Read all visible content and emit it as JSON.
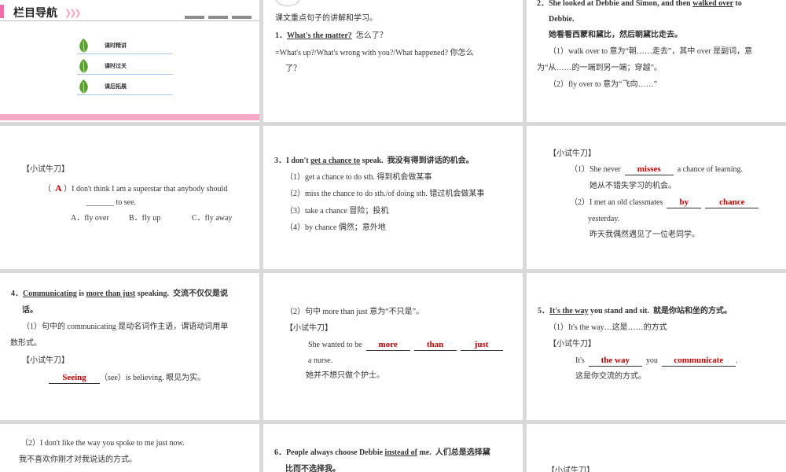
{
  "nav": {
    "title": "栏目导航",
    "arrows": "❯❯❯",
    "items": [
      {
        "label": "课时精讲"
      },
      {
        "label": "课时过关"
      },
      {
        "label": "课后拓展"
      }
    ],
    "colors": {
      "accent": "#f26ca7",
      "bar": "#f7a8c8",
      "leaf": "#5aa02c"
    }
  },
  "s2": {
    "intro": "课文重点句子的讲解和学习。",
    "heading_num": "1．",
    "heading_en": "What's the matter?",
    "heading_cn": "怎么了？",
    "line1": "=What's up?/What's wrong with you?/What happened? 你怎么",
    "line2": "了？"
  },
  "s3": {
    "h_num": "2．",
    "h_part1": "She looked at Debbie and Simon, and then",
    "h_under": "walked over",
    "h_part2": "to",
    "h_line2": "Debbie.",
    "cn": "她看看西蒙和黛比，然后朝黛比走去。",
    "p1a": "（1）walk over to 意为“朝……走去”，其中 over 是副词，意",
    "p1b": "为“从……的一端到另一端；穿越”。",
    "p2": "（2）fly over to 意为“飞向……”"
  },
  "s4": {
    "label": "【小试牛刀】",
    "paren_open": "（",
    "answer": "A",
    "paren_close": "）",
    "q1": "I don't think I am a superstar that anybody should",
    "blank": "_______",
    "q2": "to see.",
    "optA": "A．fly over",
    "optB": "B．fly up",
    "optC": "C．fly away"
  },
  "s5": {
    "h_num": "3．",
    "h_a": "I don't",
    "h_under": "get a chance to",
    "h_b": "speak.",
    "h_cn": "我没有得到讲话的机会。",
    "i1": "（1）get a chance to do sth. 得到机会做某事",
    "i2": "（2）miss the chance to do sth./of doing sth. 错过机会做某事",
    "i3": "（3）take a chance 冒险；投机",
    "i4": "（4）by chance 偶然；意外地"
  },
  "s6": {
    "label": "【小试牛刀】",
    "q1a": "（1）She never",
    "a1": "misses",
    "q1b": "a chance of learning.",
    "cn1": "她从不错失学习的机会。",
    "q2a": "（2）I met an old classmates",
    "a2a": "by",
    "a2b": "chance",
    "q2b": "yesterday.",
    "cn2": "昨天我偶然遇见了一位老同学。"
  },
  "s7": {
    "h_num": "4．",
    "h_u1": "Communicating",
    "h_is": "is",
    "h_u2": "more than just",
    "h_b": "speaking.",
    "h_cn": "交流不仅仅是说",
    "h_cn2": "话。",
    "p1a": "（1）句中的 communicating 是动名词作主语，谓语动词用单",
    "p1b": "数形式。",
    "label": "【小试牛刀】",
    "ans": "Seeing",
    "q": "（see）is believing. 眼见为实。"
  },
  "s8": {
    "p": "（2）句中 more than just 意为“不只是”。",
    "label": "【小试牛刀】",
    "q1": "She wanted to be",
    "a1": "more",
    "a2": "than",
    "a3": "just",
    "q2": "a nurse.",
    "cn": "她并不想只做个护士。"
  },
  "s9": {
    "h_num": "5．",
    "h_under": "It's the way",
    "h_b": "you stand and sit.",
    "h_cn": "就是你站和坐的方式。",
    "p1": "（1）It's the way…这是……的方式",
    "label": "【小试牛刀】",
    "q1": "It's",
    "a1": "the way",
    "q2": "you",
    "a2": "communicate",
    "q3": ".",
    "cn": "这是你交流的方式。"
  },
  "s10": {
    "p": "（2）I don't like the way you spoke to me just now.",
    "cn": "我不喜欢你刚才对我说话的方式。"
  },
  "s11": {
    "h_num": "6．",
    "h_a": "People always choose Debbie",
    "h_under": "instead of",
    "h_b": "me.",
    "h_cn": "人们总是选择黛",
    "h_cn2": "比而不选择我。"
  },
  "s12": {
    "label": "【小试牛刀】"
  }
}
